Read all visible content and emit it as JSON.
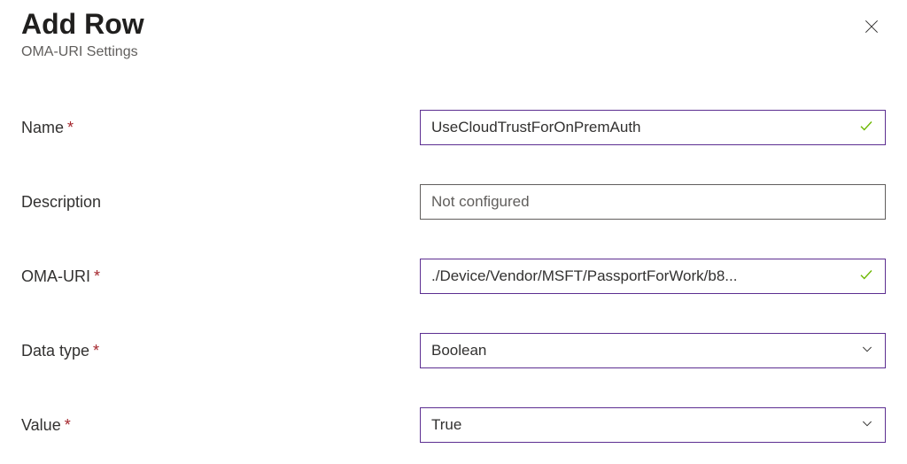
{
  "panel": {
    "title": "Add Row",
    "subtitle": "OMA-URI Settings"
  },
  "fields": {
    "name": {
      "label": "Name",
      "required": true,
      "value": "UseCloudTrustForOnPremAuth",
      "validated": true
    },
    "description": {
      "label": "Description",
      "required": false,
      "value": "",
      "placeholder": "Not configured",
      "validated": false
    },
    "omauri": {
      "label": "OMA-URI",
      "required": true,
      "value": "./Device/Vendor/MSFT/PassportForWork/b8...",
      "validated": true
    },
    "datatype": {
      "label": "Data type",
      "required": true,
      "selected": "Boolean"
    },
    "value": {
      "label": "Value",
      "required": true,
      "selected": "True"
    }
  }
}
